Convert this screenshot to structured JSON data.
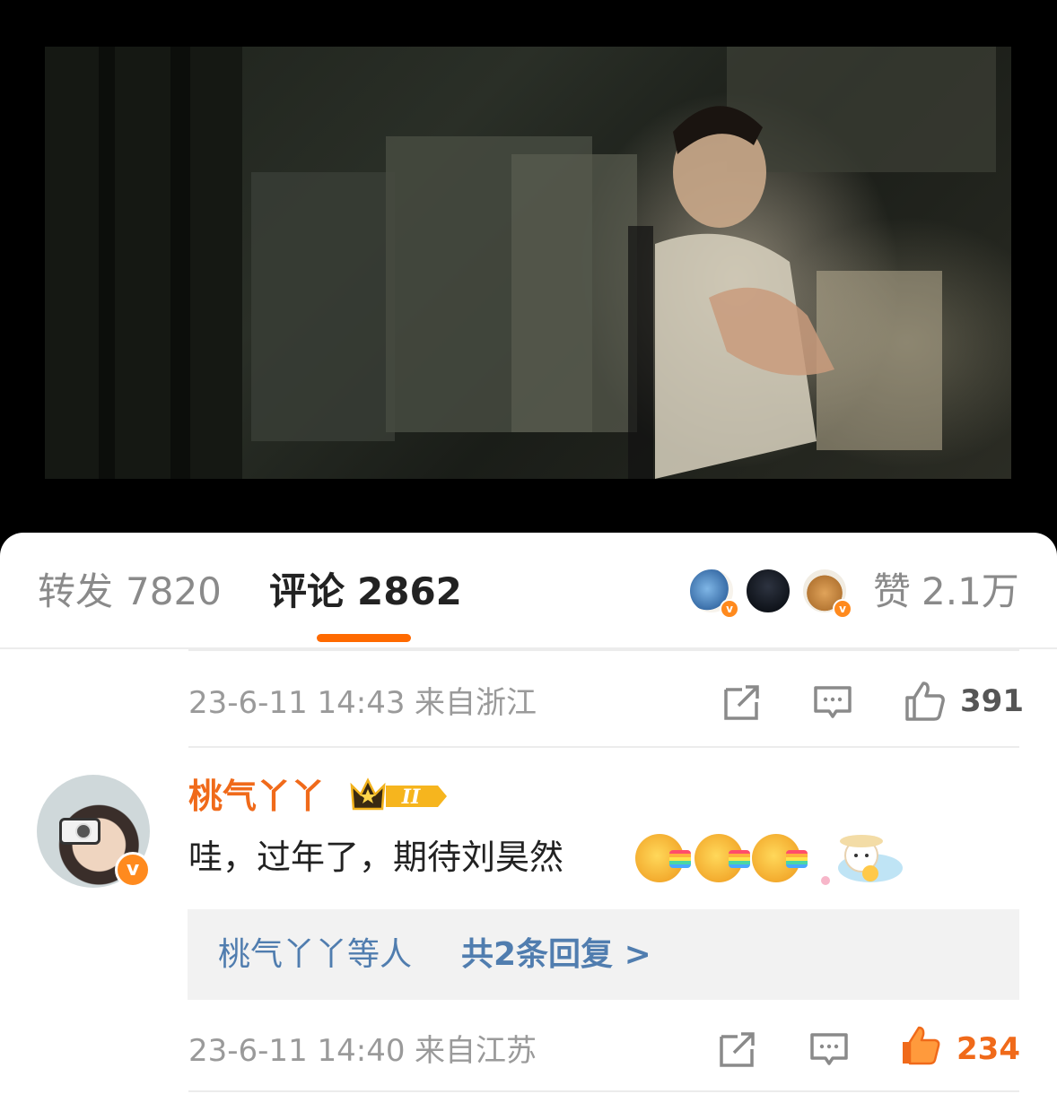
{
  "tabs": {
    "repost_label": "转发",
    "repost_count": "7820",
    "comment_label": "评论",
    "comment_count": "2862",
    "likes_label": "赞",
    "likes_count": "2.1万"
  },
  "comments": [
    {
      "time": "23-6-11 14:43",
      "location": "来自浙江",
      "like_count": "391",
      "liked": false
    },
    {
      "username": "桃气丫丫",
      "text": "哇，过年了，期待刘昊然",
      "emoji_count": 3,
      "replies_users": "桃气丫丫等人",
      "replies_link": "共2条回复 >",
      "time": "23-6-11 14:40",
      "location": "来自江苏",
      "like_count": "234",
      "liked": true
    }
  ],
  "colors": {
    "accent": "#ff6a00",
    "username": "#f06a1a",
    "link": "#507daf",
    "muted": "#9a9a9a"
  },
  "icons": [
    "share-icon",
    "comment-icon",
    "thumbs-up-icon",
    "verified-badge-icon",
    "crown-level-icon"
  ]
}
